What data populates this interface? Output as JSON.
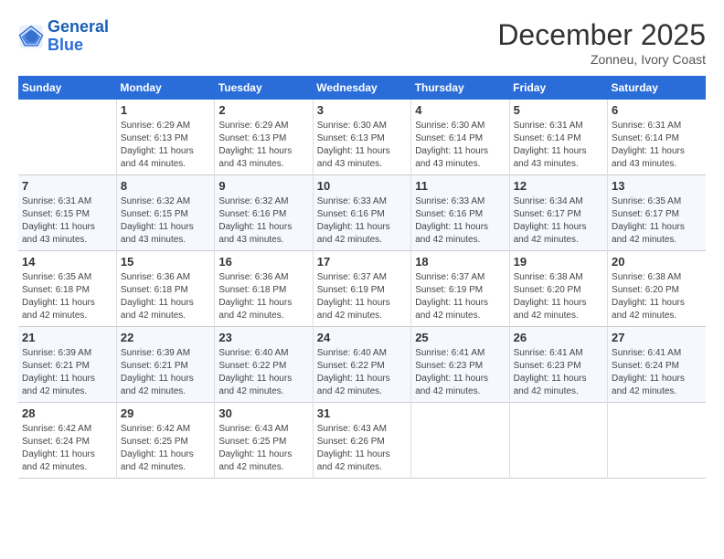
{
  "header": {
    "logo_line1": "General",
    "logo_line2": "Blue",
    "month_title": "December 2025",
    "location": "Zonneu, Ivory Coast"
  },
  "weekdays": [
    "Sunday",
    "Monday",
    "Tuesday",
    "Wednesday",
    "Thursday",
    "Friday",
    "Saturday"
  ],
  "weeks": [
    [
      {
        "day": "",
        "sunrise": "",
        "sunset": "",
        "daylight": ""
      },
      {
        "day": "1",
        "sunrise": "Sunrise: 6:29 AM",
        "sunset": "Sunset: 6:13 PM",
        "daylight": "Daylight: 11 hours and 44 minutes."
      },
      {
        "day": "2",
        "sunrise": "Sunrise: 6:29 AM",
        "sunset": "Sunset: 6:13 PM",
        "daylight": "Daylight: 11 hours and 43 minutes."
      },
      {
        "day": "3",
        "sunrise": "Sunrise: 6:30 AM",
        "sunset": "Sunset: 6:13 PM",
        "daylight": "Daylight: 11 hours and 43 minutes."
      },
      {
        "day": "4",
        "sunrise": "Sunrise: 6:30 AM",
        "sunset": "Sunset: 6:14 PM",
        "daylight": "Daylight: 11 hours and 43 minutes."
      },
      {
        "day": "5",
        "sunrise": "Sunrise: 6:31 AM",
        "sunset": "Sunset: 6:14 PM",
        "daylight": "Daylight: 11 hours and 43 minutes."
      },
      {
        "day": "6",
        "sunrise": "Sunrise: 6:31 AM",
        "sunset": "Sunset: 6:14 PM",
        "daylight": "Daylight: 11 hours and 43 minutes."
      }
    ],
    [
      {
        "day": "7",
        "sunrise": "Sunrise: 6:31 AM",
        "sunset": "Sunset: 6:15 PM",
        "daylight": "Daylight: 11 hours and 43 minutes."
      },
      {
        "day": "8",
        "sunrise": "Sunrise: 6:32 AM",
        "sunset": "Sunset: 6:15 PM",
        "daylight": "Daylight: 11 hours and 43 minutes."
      },
      {
        "day": "9",
        "sunrise": "Sunrise: 6:32 AM",
        "sunset": "Sunset: 6:16 PM",
        "daylight": "Daylight: 11 hours and 43 minutes."
      },
      {
        "day": "10",
        "sunrise": "Sunrise: 6:33 AM",
        "sunset": "Sunset: 6:16 PM",
        "daylight": "Daylight: 11 hours and 42 minutes."
      },
      {
        "day": "11",
        "sunrise": "Sunrise: 6:33 AM",
        "sunset": "Sunset: 6:16 PM",
        "daylight": "Daylight: 11 hours and 42 minutes."
      },
      {
        "day": "12",
        "sunrise": "Sunrise: 6:34 AM",
        "sunset": "Sunset: 6:17 PM",
        "daylight": "Daylight: 11 hours and 42 minutes."
      },
      {
        "day": "13",
        "sunrise": "Sunrise: 6:35 AM",
        "sunset": "Sunset: 6:17 PM",
        "daylight": "Daylight: 11 hours and 42 minutes."
      }
    ],
    [
      {
        "day": "14",
        "sunrise": "Sunrise: 6:35 AM",
        "sunset": "Sunset: 6:18 PM",
        "daylight": "Daylight: 11 hours and 42 minutes."
      },
      {
        "day": "15",
        "sunrise": "Sunrise: 6:36 AM",
        "sunset": "Sunset: 6:18 PM",
        "daylight": "Daylight: 11 hours and 42 minutes."
      },
      {
        "day": "16",
        "sunrise": "Sunrise: 6:36 AM",
        "sunset": "Sunset: 6:18 PM",
        "daylight": "Daylight: 11 hours and 42 minutes."
      },
      {
        "day": "17",
        "sunrise": "Sunrise: 6:37 AM",
        "sunset": "Sunset: 6:19 PM",
        "daylight": "Daylight: 11 hours and 42 minutes."
      },
      {
        "day": "18",
        "sunrise": "Sunrise: 6:37 AM",
        "sunset": "Sunset: 6:19 PM",
        "daylight": "Daylight: 11 hours and 42 minutes."
      },
      {
        "day": "19",
        "sunrise": "Sunrise: 6:38 AM",
        "sunset": "Sunset: 6:20 PM",
        "daylight": "Daylight: 11 hours and 42 minutes."
      },
      {
        "day": "20",
        "sunrise": "Sunrise: 6:38 AM",
        "sunset": "Sunset: 6:20 PM",
        "daylight": "Daylight: 11 hours and 42 minutes."
      }
    ],
    [
      {
        "day": "21",
        "sunrise": "Sunrise: 6:39 AM",
        "sunset": "Sunset: 6:21 PM",
        "daylight": "Daylight: 11 hours and 42 minutes."
      },
      {
        "day": "22",
        "sunrise": "Sunrise: 6:39 AM",
        "sunset": "Sunset: 6:21 PM",
        "daylight": "Daylight: 11 hours and 42 minutes."
      },
      {
        "day": "23",
        "sunrise": "Sunrise: 6:40 AM",
        "sunset": "Sunset: 6:22 PM",
        "daylight": "Daylight: 11 hours and 42 minutes."
      },
      {
        "day": "24",
        "sunrise": "Sunrise: 6:40 AM",
        "sunset": "Sunset: 6:22 PM",
        "daylight": "Daylight: 11 hours and 42 minutes."
      },
      {
        "day": "25",
        "sunrise": "Sunrise: 6:41 AM",
        "sunset": "Sunset: 6:23 PM",
        "daylight": "Daylight: 11 hours and 42 minutes."
      },
      {
        "day": "26",
        "sunrise": "Sunrise: 6:41 AM",
        "sunset": "Sunset: 6:23 PM",
        "daylight": "Daylight: 11 hours and 42 minutes."
      },
      {
        "day": "27",
        "sunrise": "Sunrise: 6:41 AM",
        "sunset": "Sunset: 6:24 PM",
        "daylight": "Daylight: 11 hours and 42 minutes."
      }
    ],
    [
      {
        "day": "28",
        "sunrise": "Sunrise: 6:42 AM",
        "sunset": "Sunset: 6:24 PM",
        "daylight": "Daylight: 11 hours and 42 minutes."
      },
      {
        "day": "29",
        "sunrise": "Sunrise: 6:42 AM",
        "sunset": "Sunset: 6:25 PM",
        "daylight": "Daylight: 11 hours and 42 minutes."
      },
      {
        "day": "30",
        "sunrise": "Sunrise: 6:43 AM",
        "sunset": "Sunset: 6:25 PM",
        "daylight": "Daylight: 11 hours and 42 minutes."
      },
      {
        "day": "31",
        "sunrise": "Sunrise: 6:43 AM",
        "sunset": "Sunset: 6:26 PM",
        "daylight": "Daylight: 11 hours and 42 minutes."
      },
      {
        "day": "",
        "sunrise": "",
        "sunset": "",
        "daylight": ""
      },
      {
        "day": "",
        "sunrise": "",
        "sunset": "",
        "daylight": ""
      },
      {
        "day": "",
        "sunrise": "",
        "sunset": "",
        "daylight": ""
      }
    ]
  ]
}
